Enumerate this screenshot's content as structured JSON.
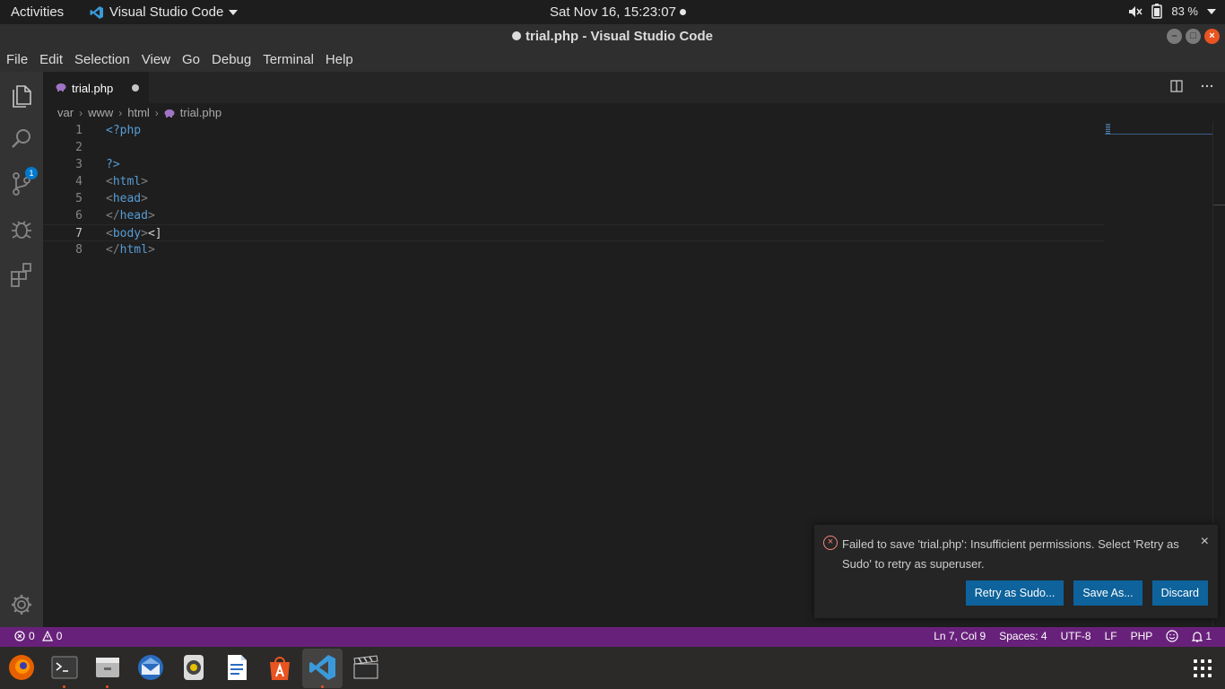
{
  "topbar": {
    "activities": "Activities",
    "app_menu": "Visual Studio Code",
    "clock": "Sat Nov 16, 15:23:07",
    "battery": "83 %"
  },
  "window": {
    "title": "trial.php - Visual Studio Code"
  },
  "menu": [
    "File",
    "Edit",
    "Selection",
    "View",
    "Go",
    "Debug",
    "Terminal",
    "Help"
  ],
  "activity_bar": {
    "explorer_badge": "1"
  },
  "tab": {
    "label": "trial.php"
  },
  "breadcrumb": [
    "var",
    "www",
    "html",
    "trial.php"
  ],
  "editor": {
    "lines": [
      {
        "num": "1",
        "open": "<?php",
        "name": "",
        "close": "",
        "after": ""
      },
      {
        "num": "2",
        "open": "",
        "name": "",
        "close": "",
        "after": ""
      },
      {
        "num": "3",
        "open": "?>",
        "name": "",
        "close": "",
        "after": ""
      },
      {
        "num": "4",
        "open": "<",
        "name": "html",
        "close": ">",
        "after": ""
      },
      {
        "num": "5",
        "open": "<",
        "name": "head",
        "close": ">",
        "after": ""
      },
      {
        "num": "6",
        "open": "</",
        "name": "head",
        "close": ">",
        "after": ""
      },
      {
        "num": "7",
        "open": "<",
        "name": "body",
        "close": ">",
        "after": "<]"
      },
      {
        "num": "8",
        "open": "</",
        "name": "html",
        "close": ">",
        "after": ""
      }
    ]
  },
  "notification": {
    "message": "Failed to save 'trial.php': Insufficient permissions. Select 'Retry as Sudo' to retry as superuser.",
    "buttons": [
      "Retry as Sudo...",
      "Save As...",
      "Discard"
    ]
  },
  "statusbar": {
    "errors": "0",
    "warnings": "0",
    "position": "Ln 7, Col 9",
    "spaces": "Spaces: 4",
    "encoding": "UTF-8",
    "eol": "LF",
    "language": "PHP",
    "notifications": "1"
  },
  "colors": {
    "statusbar": "#68217a",
    "button": "#0e639c",
    "tag": "#569cd6",
    "error": "#f48771"
  },
  "dock": [
    "firefox-icon",
    "terminal-icon",
    "files-icon",
    "thunderbird-icon",
    "rhythmbox-icon",
    "writer-icon",
    "software-center-icon",
    "vscode-icon",
    "video-editor-icon"
  ]
}
